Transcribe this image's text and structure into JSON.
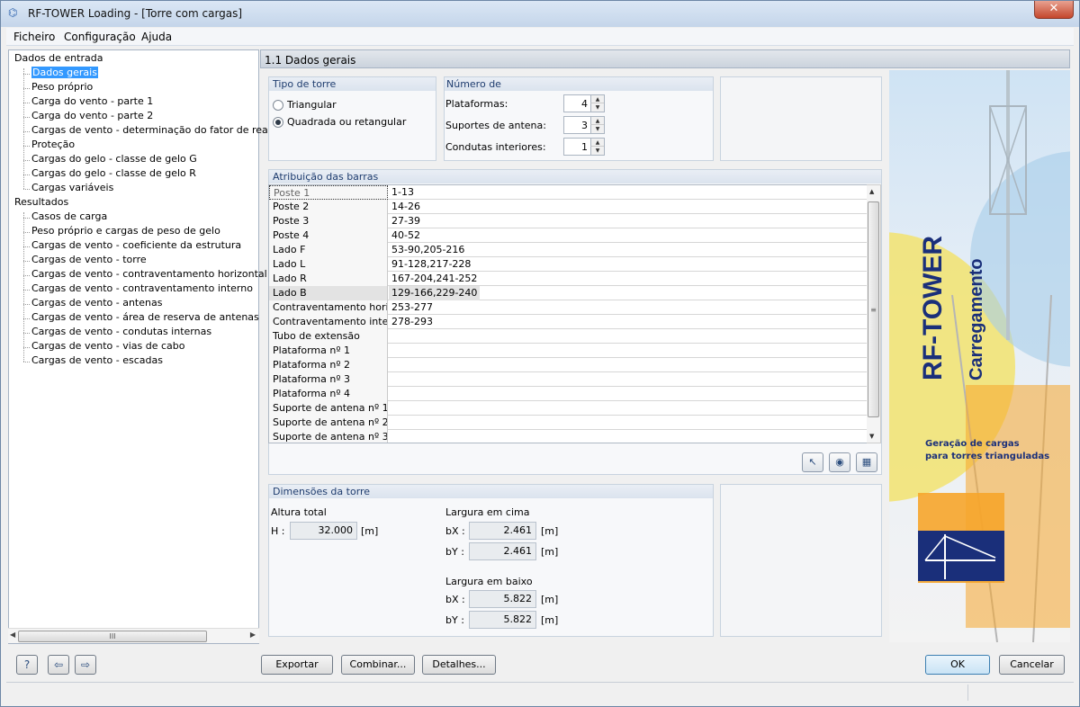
{
  "window": {
    "title": "RF-TOWER Loading - [Torre com cargas]",
    "close": "✕"
  },
  "menu": [
    "Ficheiro",
    "Configuração",
    "Ajuda"
  ],
  "nav": {
    "input_root": "Dados de entrada",
    "input_items": [
      "Dados gerais",
      "Peso próprio",
      "Carga do vento - parte 1",
      "Carga do vento - parte 2",
      "Cargas de vento - determinação do fator de reação",
      "Proteção",
      "Cargas do gelo - classe de gelo G",
      "Cargas do gelo - classe de gelo R",
      "Cargas variáveis"
    ],
    "results_root": "Resultados",
    "results_items": [
      "Casos de carga",
      "Peso próprio e cargas de peso de gelo",
      "Cargas de vento - coeficiente da estrutura",
      "Cargas de vento - torre",
      "Cargas de vento - contraventamento horizontal",
      "Cargas de vento - contraventamento interno",
      "Cargas de vento - antenas",
      "Cargas de vento - área de reserva de antenas",
      "Cargas de vento - condutas internas",
      "Cargas de vento - vias de cabo",
      "Cargas de vento - escadas"
    ],
    "selected": "Dados gerais",
    "hscroll_grip": "III"
  },
  "main": {
    "header": "1.1 Dados gerais",
    "tower_type": {
      "title": "Tipo de torre",
      "options": [
        "Triangular",
        "Quadrada ou retangular"
      ],
      "selected": "Quadrada ou retangular"
    },
    "counts": {
      "title": "Número de",
      "fields": [
        {
          "label": "Plataformas:",
          "value": "4"
        },
        {
          "label": "Suportes de antena:",
          "value": "3"
        },
        {
          "label": "Condutas interiores:",
          "value": "1"
        }
      ]
    },
    "members": {
      "title": "Atribuição das barras",
      "rows": [
        {
          "name": "Poste 1",
          "value": "1-13"
        },
        {
          "name": "Poste 2",
          "value": "14-26"
        },
        {
          "name": "Poste 3",
          "value": "27-39"
        },
        {
          "name": "Poste 4",
          "value": "40-52"
        },
        {
          "name": "Lado F",
          "value": "53-90,205-216"
        },
        {
          "name": "Lado L",
          "value": "91-128,217-228"
        },
        {
          "name": "Lado R",
          "value": "167-204,241-252"
        },
        {
          "name": "Lado B",
          "value": "129-166,229-240"
        },
        {
          "name": "Contraventamento horizo",
          "value": "253-277"
        },
        {
          "name": "Contraventamento interno",
          "value": "278-293"
        },
        {
          "name": "Tubo de extensão",
          "value": ""
        },
        {
          "name": "Plataforma nº 1",
          "value": ""
        },
        {
          "name": "Plataforma nº 2",
          "value": ""
        },
        {
          "name": "Plataforma nº 3",
          "value": ""
        },
        {
          "name": "Plataforma nº 4",
          "value": ""
        },
        {
          "name": "Suporte de antena nº 1",
          "value": ""
        },
        {
          "name": "Suporte de antena nº 2",
          "value": ""
        },
        {
          "name": "Suporte de antena nº 3",
          "value": ""
        }
      ],
      "highlighted_row": "Lado B"
    },
    "dimensions": {
      "title": "Dimensões da torre",
      "total_height": {
        "label": "Altura total",
        "sym": "H :",
        "value": "32.000",
        "unit": "[m]"
      },
      "top_width": {
        "label": "Largura em cima",
        "bx": {
          "sym": "bX :",
          "value": "2.461",
          "unit": "[m]"
        },
        "by": {
          "sym": "bY :",
          "value": "2.461",
          "unit": "[m]"
        }
      },
      "bottom_width": {
        "label": "Largura em baixo",
        "bx": {
          "sym": "bX :",
          "value": "5.822",
          "unit": "[m]"
        },
        "by": {
          "sym": "bY :",
          "value": "5.822",
          "unit": "[m]"
        }
      }
    }
  },
  "brand": {
    "name": "RF-TOWER",
    "subtitle": "Carregamento",
    "tagline_1": "Geração de cargas",
    "tagline_2": "para torres trianguladas"
  },
  "buttons": {
    "export": "Exportar",
    "combine": "Combinar...",
    "details": "Detalhes...",
    "ok": "OK",
    "cancel": "Cancelar"
  },
  "icons": [
    "help-icon",
    "previous-icon",
    "next-icon",
    "select-icon",
    "view-icon",
    "graphic-icon"
  ],
  "colors": {
    "selection": "#3399ff",
    "title_blue": "#1e3c6e",
    "brand_navy": "#1a2f7a",
    "brand_orange": "#f6a52b"
  }
}
